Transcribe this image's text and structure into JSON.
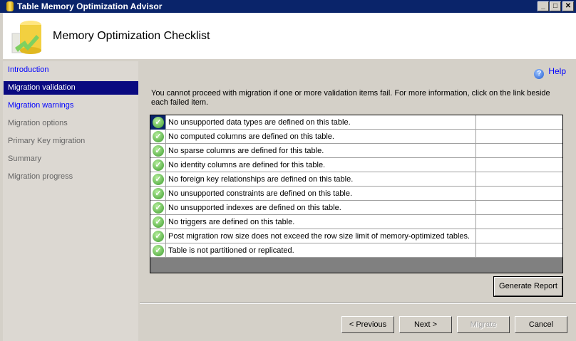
{
  "window": {
    "title": "Table Memory Optimization Advisor",
    "min": "_",
    "max": "□",
    "close": "✕"
  },
  "header": {
    "title": "Memory Optimization Checklist"
  },
  "sidebar": {
    "items": [
      {
        "label": "Introduction",
        "state": "link"
      },
      {
        "label": "Migration validation",
        "state": "sel"
      },
      {
        "label": "Migration warnings",
        "state": "link"
      },
      {
        "label": "Migration options",
        "state": "dis"
      },
      {
        "label": "Primary Key migration",
        "state": "dis"
      },
      {
        "label": "Summary",
        "state": "dis"
      },
      {
        "label": "Migration progress",
        "state": "dis"
      }
    ]
  },
  "main": {
    "help": "Help",
    "message": "You cannot proceed with migration if one or more validation items fail. For more information, click on the link beside each failed item.",
    "checks": [
      "No unsupported data types are defined on this table.",
      "No computed columns are defined on this table.",
      "No sparse columns are defined for this table.",
      "No identity columns are defined for this table.",
      "No foreign key relationships are defined on this table.",
      "No unsupported constraints are defined on this table.",
      "No unsupported indexes are defined on this table.",
      "No triggers are defined on this table.",
      "Post migration row size does not exceed the row size limit of memory-optimized tables.",
      "Table is not partitioned or replicated."
    ],
    "generate_report": "Generate Report"
  },
  "footer": {
    "previous": "< Previous",
    "next": "Next >",
    "migrate": "Migrate",
    "cancel": "Cancel"
  }
}
